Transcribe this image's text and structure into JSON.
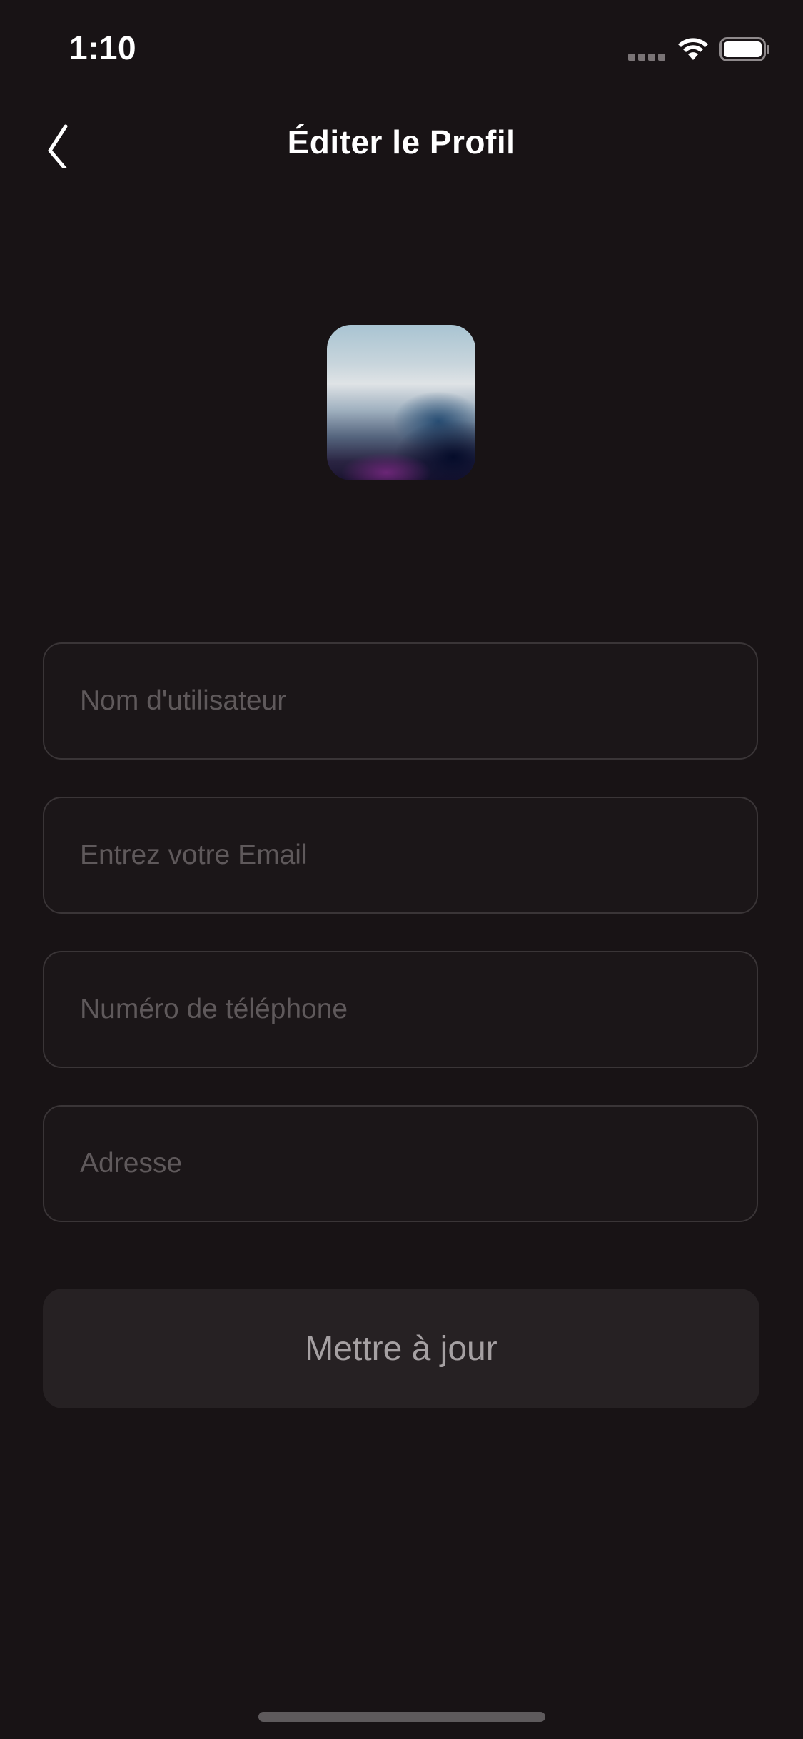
{
  "status_bar": {
    "time": "1:10",
    "icons": [
      "cellular-signal-icon",
      "wifi-icon",
      "battery-icon"
    ]
  },
  "header": {
    "title": "Éditer le Profil",
    "back_icon": "chevron-left-icon"
  },
  "form": {
    "username_placeholder": "Nom d'utilisateur",
    "email_placeholder": "Entrez votre Email",
    "phone_placeholder": "Numéro de téléphone",
    "address_placeholder": "Adresse",
    "submit_label": "Mettre à jour"
  },
  "colors": {
    "background": "#181315",
    "field_border": "#3a3537",
    "placeholder": "#5f595b",
    "button_bg": "#262123",
    "button_text": "#a5a0a2"
  }
}
